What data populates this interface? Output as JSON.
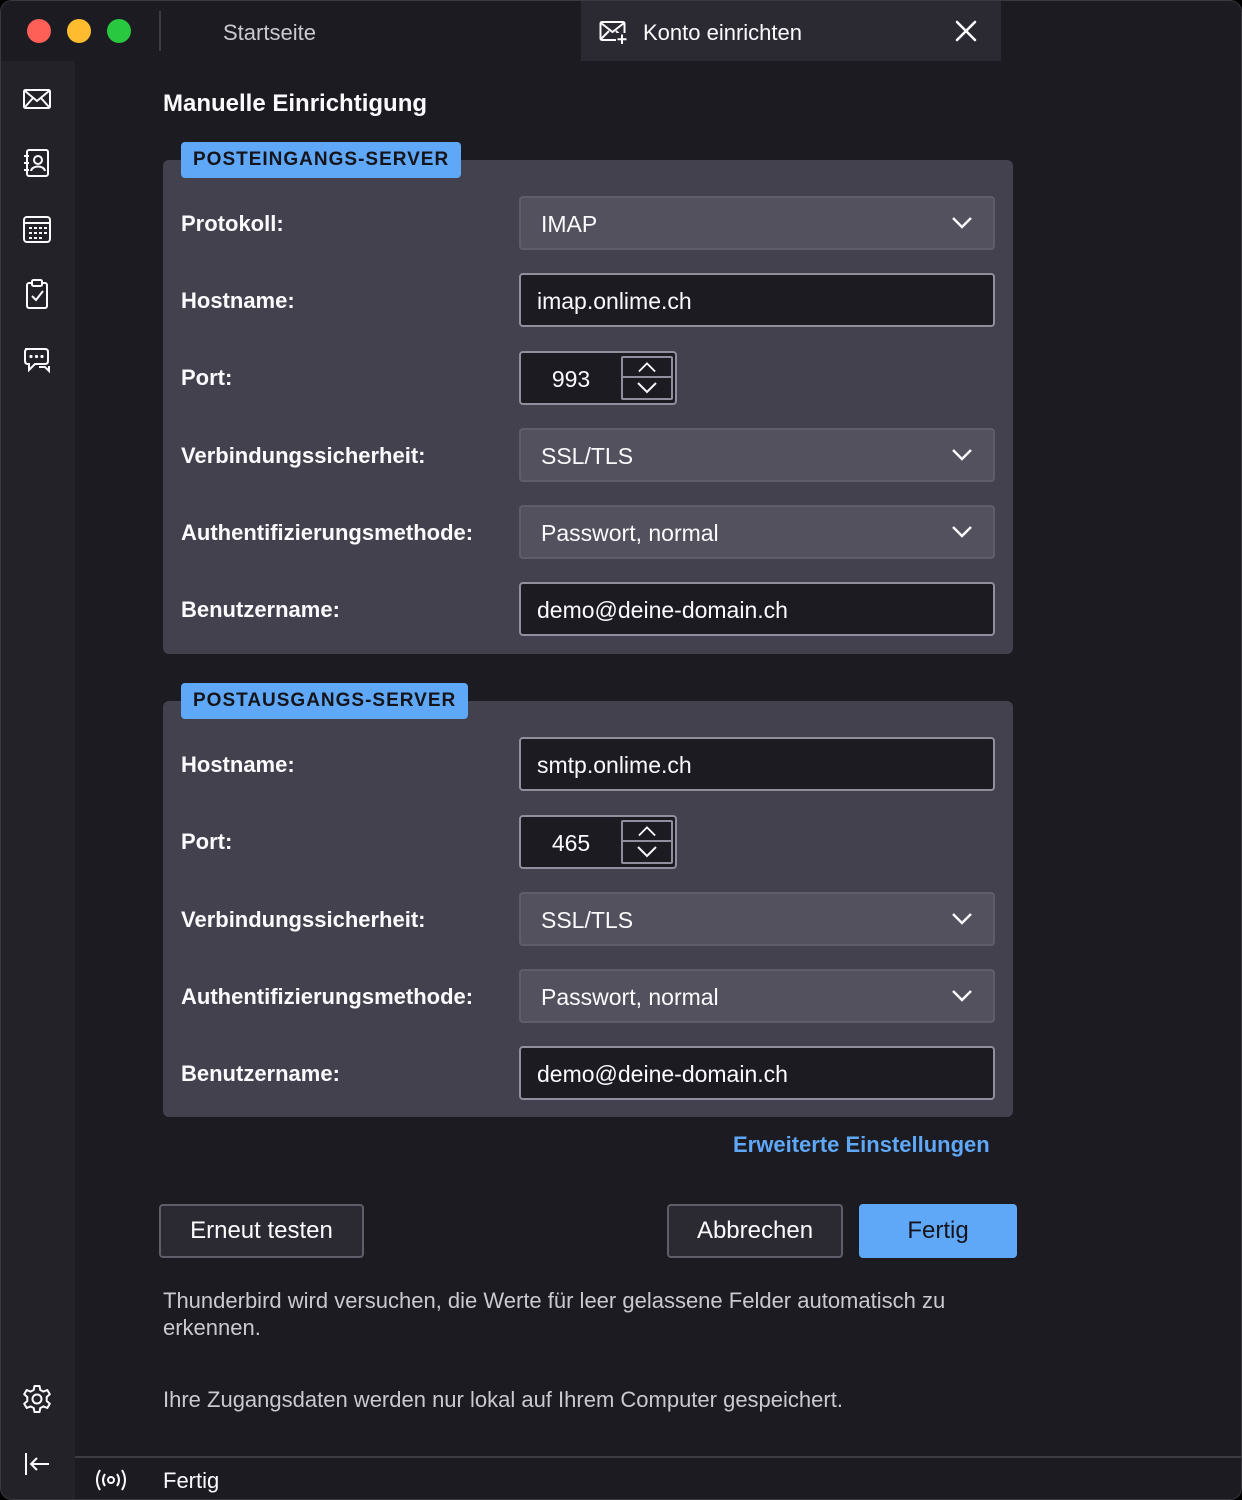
{
  "tabs": {
    "home_label": "Startseite",
    "active_label": "Konto einrichten"
  },
  "sidebar": {
    "items": [
      {
        "name": "mail-icon"
      },
      {
        "name": "address-book-icon"
      },
      {
        "name": "calendar-icon"
      },
      {
        "name": "tasks-icon"
      },
      {
        "name": "chat-icon"
      }
    ],
    "bottom": [
      {
        "name": "settings-gear-icon"
      },
      {
        "name": "collapse-sidebar-icon"
      }
    ]
  },
  "page": {
    "title": "Manuelle Einrichtigung"
  },
  "incoming": {
    "legend": "POSTEINGANGS-SERVER",
    "protocol_label": "Protokoll:",
    "protocol_value": "IMAP",
    "hostname_label": "Hostname:",
    "hostname_value": "imap.onlime.ch",
    "port_label": "Port:",
    "port_value": "993",
    "security_label": "Verbindungssicherheit:",
    "security_value": "SSL/TLS",
    "auth_label": "Authentifizierungsmethode:",
    "auth_value": "Passwort, normal",
    "username_label": "Benutzername:",
    "username_value": "demo@deine-domain.ch"
  },
  "outgoing": {
    "legend": "POSTAUSGANGS-SERVER",
    "hostname_label": "Hostname:",
    "hostname_value": "smtp.onlime.ch",
    "port_label": "Port:",
    "port_value": "465",
    "security_label": "Verbindungssicherheit:",
    "security_value": "SSL/TLS",
    "auth_label": "Authentifizierungsmethode:",
    "auth_value": "Passwort, normal",
    "username_label": "Benutzername:",
    "username_value": "demo@deine-domain.ch"
  },
  "advanced_link": "Erweiterte Einstellungen",
  "buttons": {
    "retest": "Erneut testen",
    "cancel": "Abbrechen",
    "done": "Fertig"
  },
  "notes": {
    "autodetect": "Thunderbird wird versuchen, die Werte für leer gelassene Felder automatisch zu erkennen.",
    "privacy": "Ihre Zugangsdaten werden nur lokal auf Ihrem Computer gespeichert."
  },
  "status": {
    "text": "Fertig"
  },
  "colors": {
    "accent": "#5ea8f7",
    "background": "#1c1b22",
    "panel": "#42414d"
  }
}
